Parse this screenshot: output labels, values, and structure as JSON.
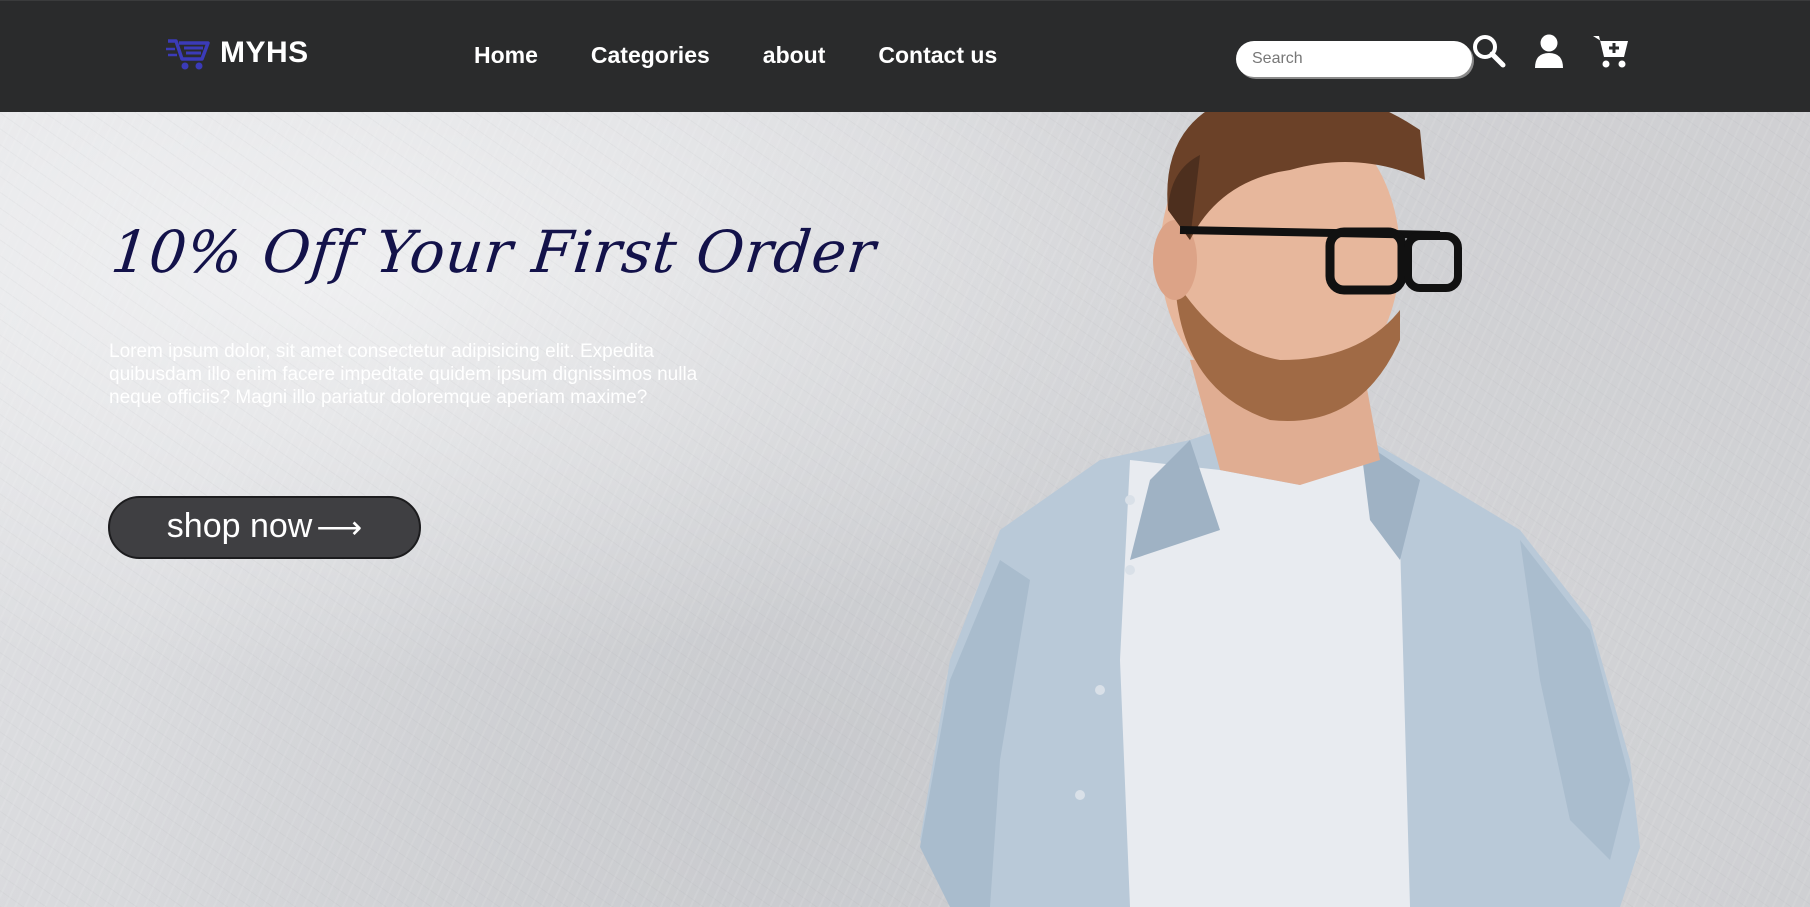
{
  "header": {
    "brand": "MYHS",
    "nav": [
      {
        "label": "Home"
      },
      {
        "label": "Categories"
      },
      {
        "label": "about"
      },
      {
        "label": "Contact us"
      }
    ],
    "search": {
      "placeholder": "Search",
      "value": ""
    },
    "icons": [
      "cart-logo-icon",
      "search-icon",
      "user-icon",
      "cart-plus-icon"
    ]
  },
  "hero": {
    "headline": "10% Off Your First Order",
    "description": "Lorem ipsum dolor, sit amet consectetur adipisicing elit. Expedita quibusdam illo enim facere impedtate quidem ipsum dignissimos nulla neque officiis? Magni illo pariatur doloremque aperiam maxime?",
    "cta": {
      "label": "shop now",
      "arrow": "⟶"
    }
  },
  "colors": {
    "nav_background": "#2a2b2c",
    "brand_icon": "#3b3bb8",
    "headline": "#13124a",
    "button": "#3f3f42"
  }
}
